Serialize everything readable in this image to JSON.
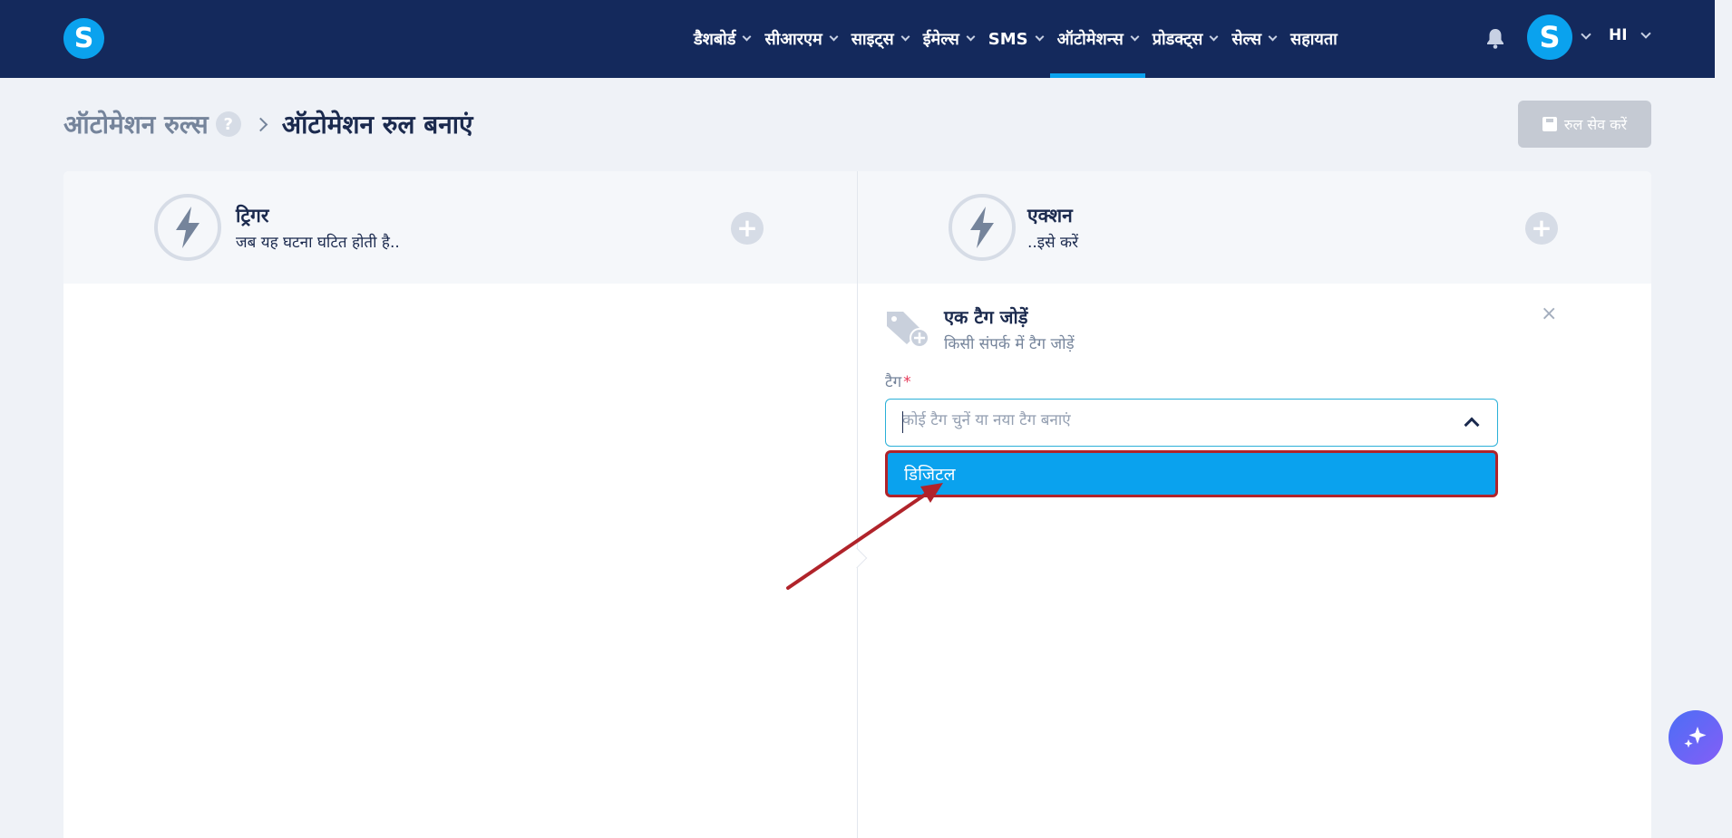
{
  "app": {
    "logo_letter": "S"
  },
  "nav": {
    "items": [
      {
        "label": "डैशबोर्ड",
        "has_chevron": true,
        "active": false
      },
      {
        "label": "सीआरएम",
        "has_chevron": true,
        "active": false
      },
      {
        "label": "साइट्स",
        "has_chevron": true,
        "active": false
      },
      {
        "label": "ईमेल्स",
        "has_chevron": true,
        "active": false
      },
      {
        "label": "SMS",
        "has_chevron": true,
        "active": false
      },
      {
        "label": "ऑटोमेशन्स",
        "has_chevron": true,
        "active": true
      },
      {
        "label": "प्रोडक्ट्स",
        "has_chevron": true,
        "active": false
      },
      {
        "label": "सेल्स",
        "has_chevron": true,
        "active": false
      },
      {
        "label": "सहायता",
        "has_chevron": false,
        "active": false
      }
    ],
    "avatar_letter": "S",
    "language": "HI"
  },
  "header": {
    "breadcrumb_parent": "ऑटोमेशन रुल्स",
    "help_icon": "?",
    "breadcrumb_current": "ऑटोमेशन रुल बनाएं",
    "save_label": "रुल सेव करें"
  },
  "trigger": {
    "title": "ट्रिगर",
    "subtitle": "जब यह घटना घटित होती है..",
    "plus": "+"
  },
  "action": {
    "title": "एक्शन",
    "subtitle": "..इसे करें",
    "plus": "+"
  },
  "add_tag": {
    "title": "एक टैग जोड़ें",
    "subtitle": "किसी संपर्क में टैग जोड़ें",
    "close": "×",
    "field_label": "टैग",
    "required_mark": "*",
    "placeholder": "कोई टैग चुनें या नया टैग बनाएं",
    "options": [
      "डिजिटल"
    ]
  },
  "colors": {
    "topbar": "#14295c",
    "accent": "#0aa2ee",
    "highlight_border": "#b0232a",
    "annotation_arrow": "#b0232a"
  },
  "icons": [
    "bell-icon",
    "bolt-icon",
    "tag-plus-icon",
    "close-icon",
    "chevron-down-icon",
    "chevron-up-icon",
    "save-icon",
    "sparkle-icon"
  ]
}
